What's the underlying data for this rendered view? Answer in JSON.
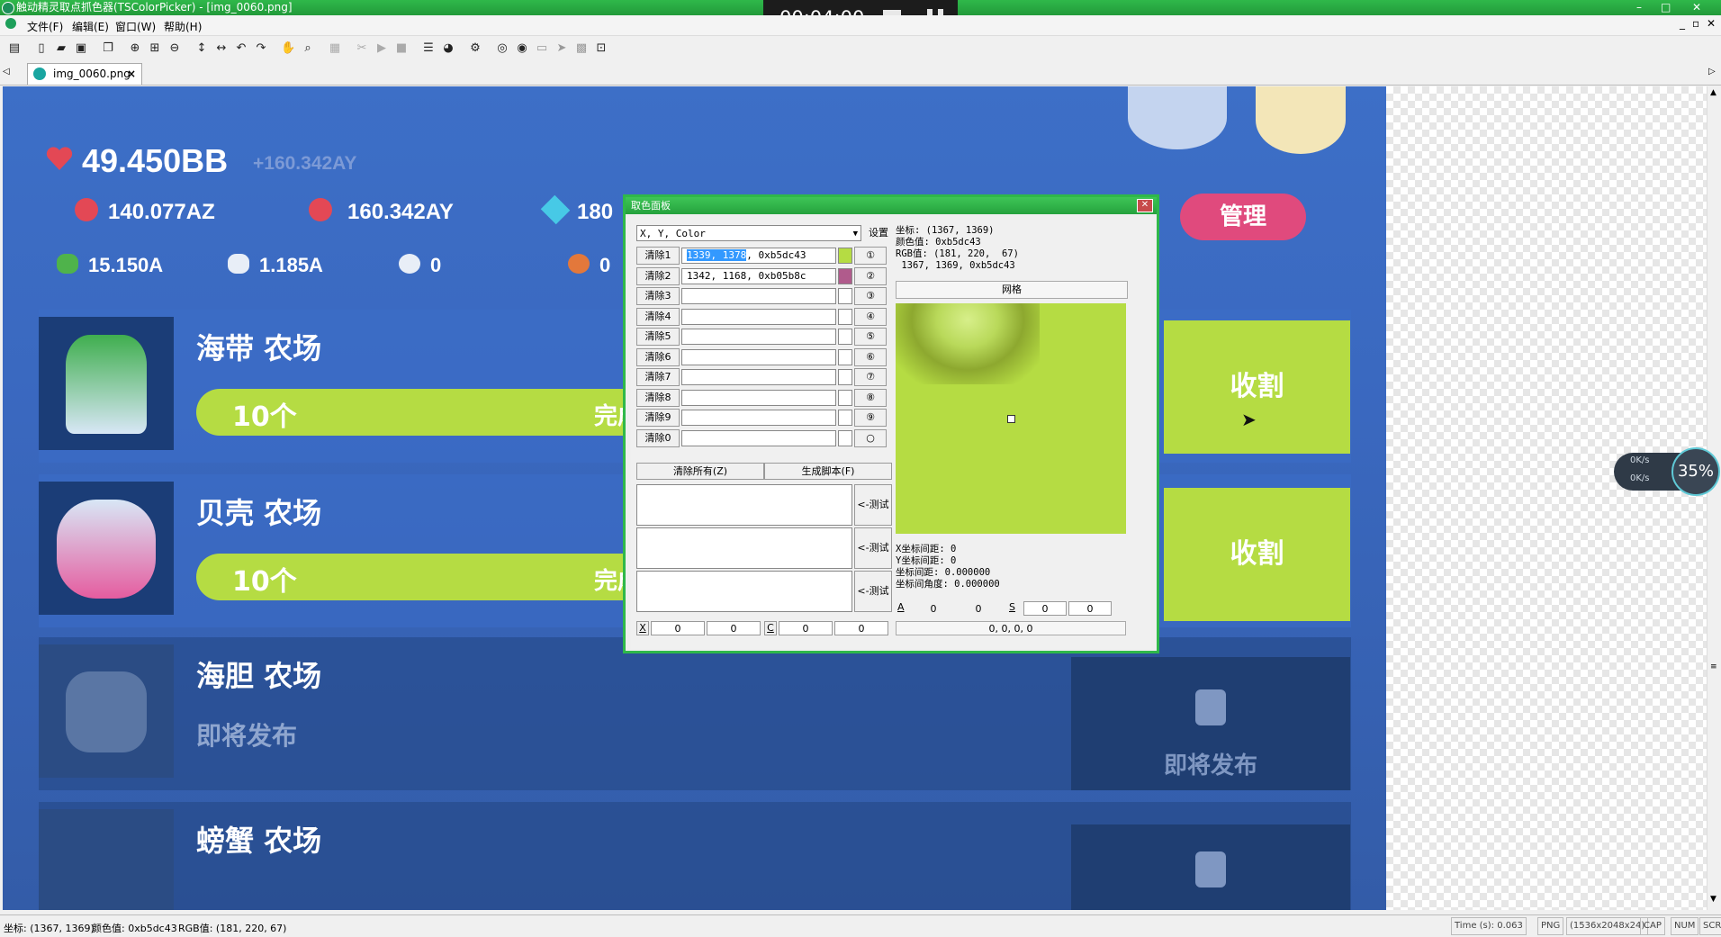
{
  "window": {
    "title": "触动精灵取点抓色器(TSColorPicker) - [img_0060.png]",
    "controls": [
      "–",
      "□",
      "✕"
    ]
  },
  "recorder": {
    "time": "00:04:00"
  },
  "menu": {
    "items": [
      "文件(F)",
      "编辑(E)",
      "窗口(W)",
      "帮助(H)"
    ]
  },
  "tab": {
    "label": "img_0060.png",
    "close": "×"
  },
  "game": {
    "love_total": "49.450BB",
    "love_rate": "+160.342AY",
    "stats_row1": [
      "140.077AZ",
      "160.342AY",
      "180"
    ],
    "stats_row2": [
      "15.150A",
      "1.185A",
      "0",
      "0"
    ],
    "manage_label": "管理",
    "farms": [
      {
        "name": "海带 农场",
        "count": "10个",
        "done": "完成生",
        "action": "收割"
      },
      {
        "name": "贝壳 农场",
        "count": "10个",
        "done": "完成生",
        "action": "收割"
      },
      {
        "name": "海胆 农场",
        "status": "即将发布",
        "action": "即将发布"
      },
      {
        "name": "螃蟹 农场"
      }
    ]
  },
  "dialog": {
    "title": "取色面板",
    "mode": "X, Y, Color",
    "settings": "设置",
    "slots": [
      {
        "clear": "清除1",
        "value_hl": "1339, 1378",
        "value_rest": ", 0xb5dc43",
        "color": "#b5dc43",
        "num": "①"
      },
      {
        "clear": "清除2",
        "value_hl": "",
        "value_rest": "1342, 1168, 0xb05b8c",
        "color": "#b05b8c",
        "num": "②"
      },
      {
        "clear": "清除3",
        "value_hl": "",
        "value_rest": "",
        "color": "#ffffff",
        "num": "③"
      },
      {
        "clear": "清除4",
        "value_hl": "",
        "value_rest": "",
        "color": "#ffffff",
        "num": "④"
      },
      {
        "clear": "清除5",
        "value_hl": "",
        "value_rest": "",
        "color": "#ffffff",
        "num": "⑤"
      },
      {
        "clear": "清除6",
        "value_hl": "",
        "value_rest": "",
        "color": "#ffffff",
        "num": "⑥"
      },
      {
        "clear": "清除7",
        "value_hl": "",
        "value_rest": "",
        "color": "#ffffff",
        "num": "⑦"
      },
      {
        "clear": "清除8",
        "value_hl": "",
        "value_rest": "",
        "color": "#ffffff",
        "num": "⑧"
      },
      {
        "clear": "清除9",
        "value_hl": "",
        "value_rest": "",
        "color": "#ffffff",
        "num": "⑨"
      },
      {
        "clear": "清除0",
        "value_hl": "",
        "value_rest": "",
        "color": "#ffffff",
        "num": "○"
      }
    ],
    "clear_all": "清除所有(Z)",
    "gen_script": "生成脚本(F)",
    "test_label": "<-测试",
    "info": "坐标: (1367, 1369)\n颜色值: 0xb5dc43\nRGB值: (181, 220,  67)\n 1367, 1369, 0xb5dc43",
    "grid": "网格",
    "dist": "X坐标间距: 0\nY坐标间距: 0\n坐标间距: 0.000000\n坐标间角度: 0.000000",
    "x_label": "X",
    "c_label": "C",
    "a_label": "A",
    "s_label": "S",
    "fields": [
      "0",
      "0",
      "0",
      "0"
    ],
    "fields_right": [
      "0",
      "0",
      "0",
      "0"
    ],
    "rgba": "0, 0, 0, 0"
  },
  "network": {
    "up": "0K/s",
    "down": "0K/s",
    "percent": "35%"
  },
  "status": {
    "coord": "坐标: (1367, 1369)",
    "color": "颜色值: 0xb5dc43",
    "rgb": "RGB值: (181, 220, 67)",
    "time": "Time (s): 0.063",
    "format": "PNG",
    "size": "(1536x2048x24)",
    "cap": "CAP",
    "num": "NUM",
    "scr": "SCR"
  },
  "colors": {
    "accent": "#2fb84a",
    "lime": "#b5dc43",
    "pink": "#b05b8c",
    "game_blue": "#3a68bf",
    "manage": "#e04a7d"
  }
}
